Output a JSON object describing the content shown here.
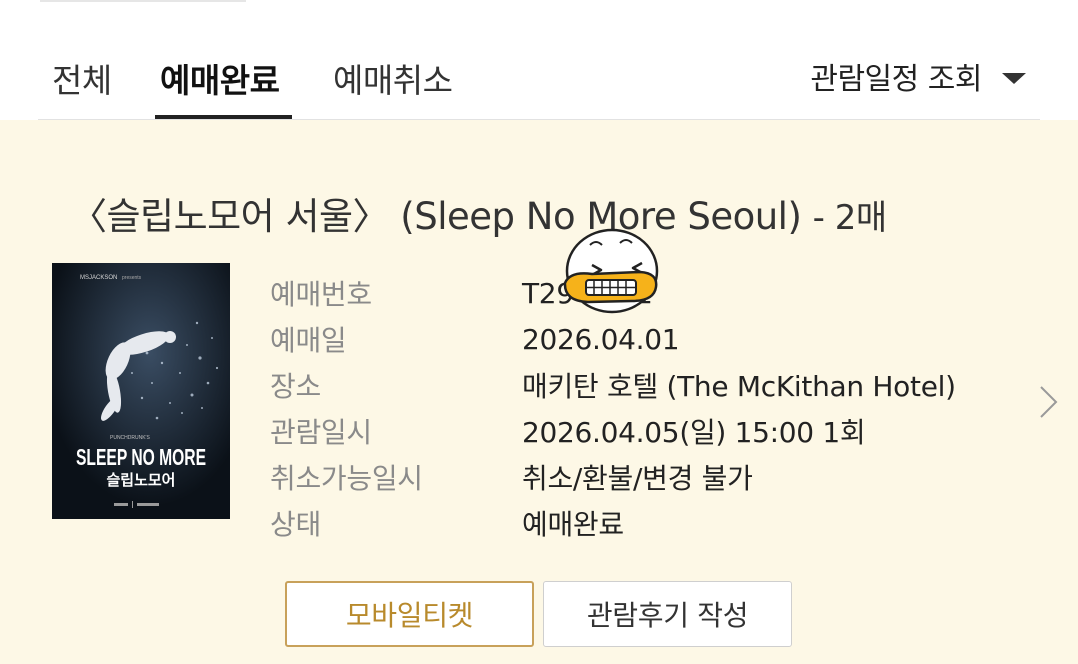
{
  "tabs": [
    {
      "label": "전체"
    },
    {
      "label": "예매완료"
    },
    {
      "label": "예매취소"
    }
  ],
  "schedule_filter": {
    "label": "관람일정 조회"
  },
  "booking": {
    "title": "〈슬립노모어 서울〉 (Sleep No More Seoul)",
    "quantity": "- 2매",
    "poster": {
      "presenter": "MSJACKSON",
      "presents": "presents",
      "punchdrunk": "PUNCHDRUNK'S",
      "title_en": "SLEEP NO MORE",
      "title_ko": "슬립노모어"
    },
    "fields": [
      {
        "label": "예매번호",
        "value": "T29      7871"
      },
      {
        "label": "예매일",
        "value": "2026.04.01"
      },
      {
        "label": "장소",
        "value": "매키탄 호텔 (The McKithan Hotel)"
      },
      {
        "label": "관람일시",
        "value": "2026.04.05(일) 15:00 1회"
      },
      {
        "label": "취소가능일시",
        "value": "취소/환불/변경 불가"
      },
      {
        "label": "상태",
        "value": "예매완료"
      }
    ]
  },
  "buttons": {
    "mobile_ticket": "모바일티켓",
    "write_review": "관람후기 작성"
  },
  "colors": {
    "card_background": "#fdf8e6",
    "accent_gold": "#b88a2c",
    "accent_border": "#c8a15a"
  },
  "icons": {
    "dropdown": "caret-down-icon",
    "detail": "chevron-right-icon",
    "sticker": "laughing-duck-sticker"
  }
}
